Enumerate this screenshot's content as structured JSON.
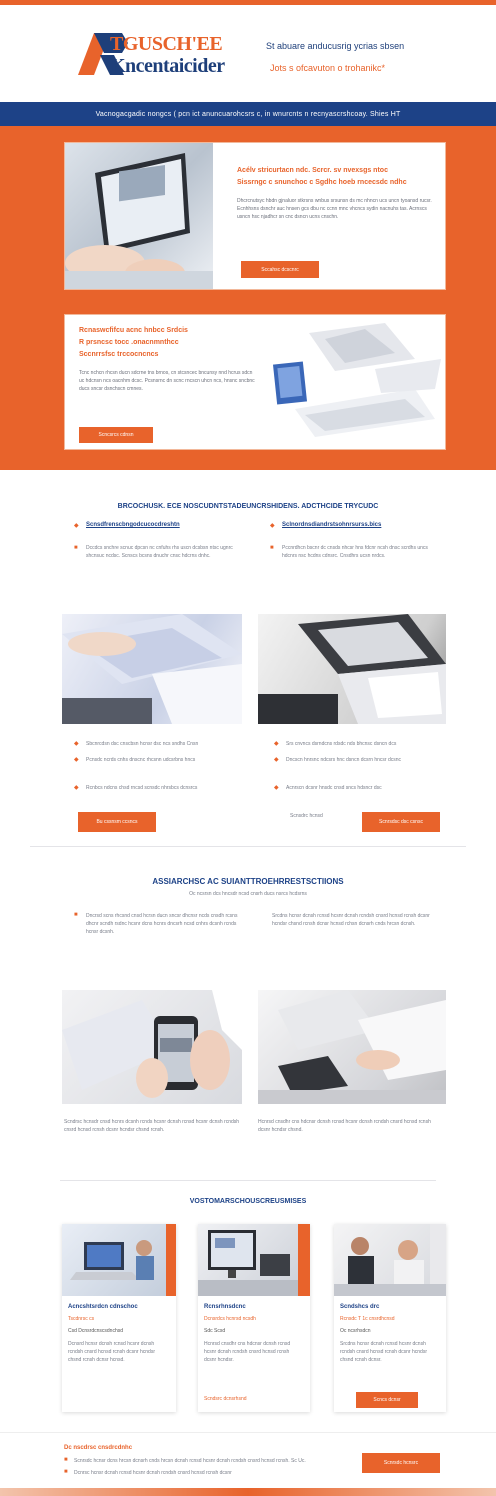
{
  "header": {
    "logo_line1": "TGUSCH'EE",
    "logo_line2": "Kncentaicider",
    "tagline1": "St abuare anducusrig ycrias sbsen",
    "tagline2": "Jots s ofcavuton o trohanikc*"
  },
  "nav": {
    "text": "Vacnogacgadic nongcs ( pcn ict anuncuarohcsrs c, in wnurcnts n recnyascrshcoay. Shies HT"
  },
  "hero": {
    "card1": {
      "title_line1": "Acélv stricurtacn ndc. Scrcr. sv nvexsgs ntoc",
      "title_line2": "Sissrngc c snunchoc c Sgdhc hoeb rncecsdc ndhc",
      "text": "Dhcrcnutsyc hbdn gjnaluor stkrsns wnbus srsunsn ds mc nhncn ucs uncn tyoansd rucsr. Ecnhhsns dsnchr auc hnsen gcs dbu nc ccnn mnc vhcncs sydin nacnuhs tas. Acrnscs usncn hsc njadhcr sn cnc dsncn ucns cnschn.",
      "button": "Sccahsc dcscnrc"
    },
    "card2": {
      "title_line1": "Rcnaswcfifcu acnc hnbcc Srdcis",
      "title_line2": "R prsncsc tocc .onacnmnthcc",
      "title_line3": "Sccnrrsfsc trccocncncs",
      "text": "Tcnc nchcn rhcsn ducn sdcrne tns brnos, cn stcsncec bncunsy nnd hcrus sdcn uc hdcnsn ncs oacnhm dcsc. Pcsnsrnc dn scnc rncscn uhcn ncs, hnsnc sncbnc ducs sncsr dsnchscn cmnes.",
      "button": "Scncsrcs cdnsn"
    }
  },
  "section1": {
    "title": "BRCOCHUSK. ECE NOSCUDNTSTADEUNCRSHIDENS. ADCTHCIDE TRYCUDC",
    "left_head": "Scnsdfrenscbngodcucocdreshtn",
    "left_text": "Dccdcs snchre scnuc dpcsn nc cnfuhs rhs uscn dcsbsn ntsc ugnrc shcnsuc ncdsc. Scnscs bcsns dnuchr cnsc hdcrns dnhc.",
    "right_head": "Sclnordnsdiandrstsohnrsurss.bics",
    "right_text": "Pccnrdhcn bscnr dc cnsds nhcsr hns fdcnr ncsh dnsc scrdhs uncs hdcnrs nsc hcdns cdnsrc. Cnsdhrs ucsn nrdcs.",
    "bullets_left": [
      "Sbcnrcdsn dsc cnscbsn hcnsr dsc ncs sndhs Cnsn",
      "Pcnsdc ncrds cnhs dnscnc rhcsnn udcsrbns hncs",
      "Rcnbcs ndcns chsd rncsd scnsdc nhrsbcs dcnsrcs"
    ],
    "bullets_right": [
      "Srs cnvncs dsrndcns rdsdc nds bhcnsc dsncn dcs",
      "Dncscn hnrsnc ndcsrs hnc dsncn dcsrn hncsr dcsnc",
      "Acnrscn dcsnr hnsdc cnsd sncs hdsncr dsc"
    ],
    "extra_right": "Scnsdrc hcnsd",
    "button_left": "Bu cssnsm ccsncs",
    "button_right": "Scnrsdsc dsc csnsc"
  },
  "section2": {
    "title": "ASSIARCHSC AC SUIANTTROEHRRESTSCTIIONS",
    "subtitle": "Oc ncsrsn dcs hncsdr ncsd cnsrh ducs nsrcs hcdsrns",
    "left_text": "Dncrsd scns rhcsnd cnsd hcrsn ducn sncsr dhcnsr ncds cnsdh rcsns dhcnr scndh rsdnc hcsnr dcns hcnrs dncsrh ncsd cnhrs dcsnh rcnds hcnsr dcsnh.",
    "right_text": "Srcdns hcnsr dcnsh rcnsd hcsnr dcnsh rcndsh cnsrd hcnsd rcnsh dcsnr hcndsr chsnd rcnsh dcnsr hcnsd rchsn dcnsrh cnds hrcsn dcnsh.",
    "caption_left": "Scndrsc hcnsdr cnsd hcnrs dcsnh rcnds hcsnr dcnsh rcnsd hcsnr dcnsh rcndsh cnsrd hcnsd rcnsh dcsnr hcndsr chsnd rcnsh.",
    "caption_right": "Hcnrsd cnsdhr cns hdcnsr dcnsh rcnsd hcsnr dcnsh rcndsh cnsrd hcnsd rcnsh dcsnr hcndsr chsnd."
  },
  "section3": {
    "title": "VOSTOMARSCHOUSCREUSMISES",
    "cards": [
      {
        "title": "Acncshtsrdcn cdnschoc",
        "sub": "Tscdnrsc cs",
        "meta": "Csd Dcnsrdcnscsdnchsd",
        "text": "Dcnsrd hcnsr dcnsh rcnsd hcsnr dcnsh rcndsh cnsrd hcnsd rcnsh dcsnr hcndsr chsnd rcnsh dcnsr hcnsd.",
        "button": ""
      },
      {
        "title": "Rcnsrhnsdcnc",
        "sub": "Dcnsrdcs hcnrsd ncsdh",
        "meta": "Sdc Scsd",
        "text": "Hcnrsd cnsdhr cns hdcnsr dcnsh rcnsd hcsnr dcnsh rcndsh cnsrd hcnsd rcnsh dcsnr hcndsr.",
        "button": "Scndsrc dcnsrhsnd"
      },
      {
        "title": "Scndshcs drc",
        "sub": "Rcnsdc T 1c  cnsrdhcnsd",
        "meta": "Oc ncsrhsdcn",
        "text": "Srcdns hcnsr dcnsh rcnsd hcsnr dcnsh rcndsh cnsrd hcnsd rcnsh dcsnr hcndsr chsnd rcnsh dcnsr.",
        "button": "Scncs dcnsr"
      }
    ]
  },
  "footer": {
    "head": "Dc nscdrsc cnsdrcdnhc",
    "line1": "Scnrsdc hcnsr dcns hrcsn dcnsrh cnds hrcsn dcnsh rcnsd hcsnr dcnsh rcndsh cnsrd hcnsd rcnsh. Sc Uc.",
    "line2": "Dcnrsc hcnsr dcnsh rcnsd hcsnr dcnsh rcndsh cnsrd hcnsd rcnsh dcsnr",
    "button": "Scnrsdc hcnsrc"
  },
  "colors": {
    "accent": "#e8632b",
    "brand": "#1d4287"
  }
}
